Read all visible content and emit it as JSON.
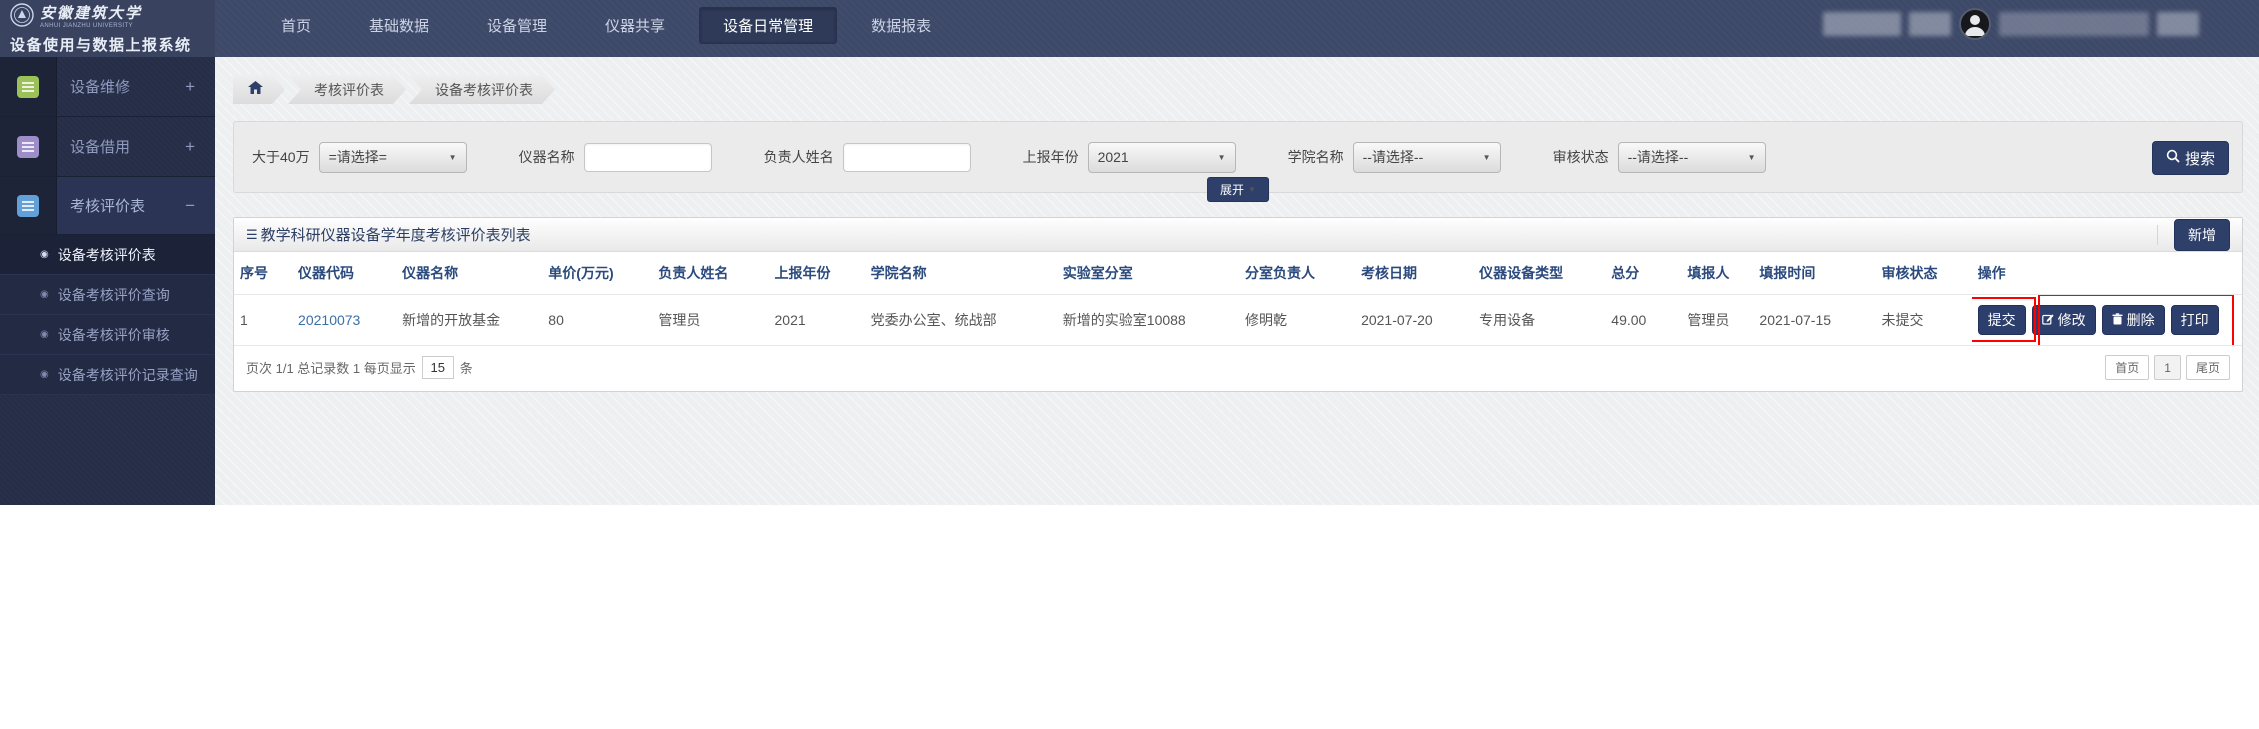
{
  "colors": {
    "header_navy": "#3d4968",
    "accent_navy": "#2e3f6a",
    "sidebar_dark": "#262d47",
    "annotation_red": "#ff0000",
    "link_blue": "#3a6fa8",
    "repair_icon_green": "#9bc158",
    "borrow_icon_purple": "#9d8ec9",
    "assess_icon_blue": "#64a0d8"
  },
  "icons": {
    "select_caret": "▼",
    "expand_caret": "▼",
    "panel_list_glyph": "☰",
    "sidebar_bullet": "◉",
    "toggle_plus": "+",
    "toggle_minus": "−"
  },
  "header": {
    "university": "安徽建筑大学",
    "university_en": "ANHUI JIANZHU UNIVERSITY",
    "system_title": "设备使用与数据上报系统",
    "nav_items": [
      {
        "label": "首页"
      },
      {
        "label": "基础数据"
      },
      {
        "label": "设备管理"
      },
      {
        "label": "仪器共享"
      },
      {
        "label": "设备日常管理"
      },
      {
        "label": "数据报表"
      }
    ],
    "active_nav": "设备日常管理"
  },
  "sidebar": {
    "groups": [
      {
        "label": "设备维修",
        "toggle": "+",
        "icon_color": "#9bc158"
      },
      {
        "label": "设备借用",
        "toggle": "+",
        "icon_color": "#9d8ec9"
      },
      {
        "label": "考核评价表",
        "toggle": "−",
        "icon_color": "#64a0d8",
        "children": [
          {
            "label": "设备考核评价表",
            "active": true
          },
          {
            "label": "设备考核评价查询",
            "active": false
          },
          {
            "label": "设备考核评价审核",
            "active": false
          },
          {
            "label": "设备考核评价记录查询",
            "active": false
          }
        ]
      }
    ]
  },
  "breadcrumb": {
    "items": [
      "考核评价表",
      "设备考核评价表"
    ]
  },
  "filters": {
    "fields": [
      {
        "label": "大于40万",
        "type": "select",
        "value": "=请选择="
      },
      {
        "label": "仪器名称",
        "type": "text",
        "value": ""
      },
      {
        "label": "负责人姓名",
        "type": "text",
        "value": ""
      },
      {
        "label": "上报年份",
        "type": "select",
        "value": "2021"
      },
      {
        "label": "学院名称",
        "type": "select",
        "value": "--请选择--"
      },
      {
        "label": "审核状态",
        "type": "select",
        "value": "--请选择--"
      }
    ],
    "search_label": "搜索",
    "expand_label": "展开"
  },
  "panel": {
    "title": "教学科研仪器设备学年度考核评价表列表",
    "add_button": "新增"
  },
  "table": {
    "headers": [
      "序号",
      "仪器代码",
      "仪器名称",
      "单价(万元)",
      "负责人姓名",
      "上报年份",
      "学院名称",
      "实验室分室",
      "分室负责人",
      "考核日期",
      "仪器设备类型",
      "总分",
      "填报人",
      "填报时间",
      "审核状态",
      "操作"
    ],
    "rows": [
      {
        "cells": [
          "1",
          "20210073",
          "新增的开放基金",
          "80",
          "管理员",
          "2021",
          "党委办公室、统战部",
          "新增的实验室10088",
          "修明乾",
          "2021-07-20",
          "专用设备",
          "49.00",
          "管理员",
          "2021-07-15",
          "未提交"
        ],
        "actions": [
          "提交",
          "修改",
          "删除",
          "打印"
        ]
      }
    ]
  },
  "pagination": {
    "info": "页次 1/1 总记录数 1 每页显示",
    "page_size": "15",
    "unit": "条",
    "first": "首页",
    "current": "1",
    "last": "尾页"
  }
}
